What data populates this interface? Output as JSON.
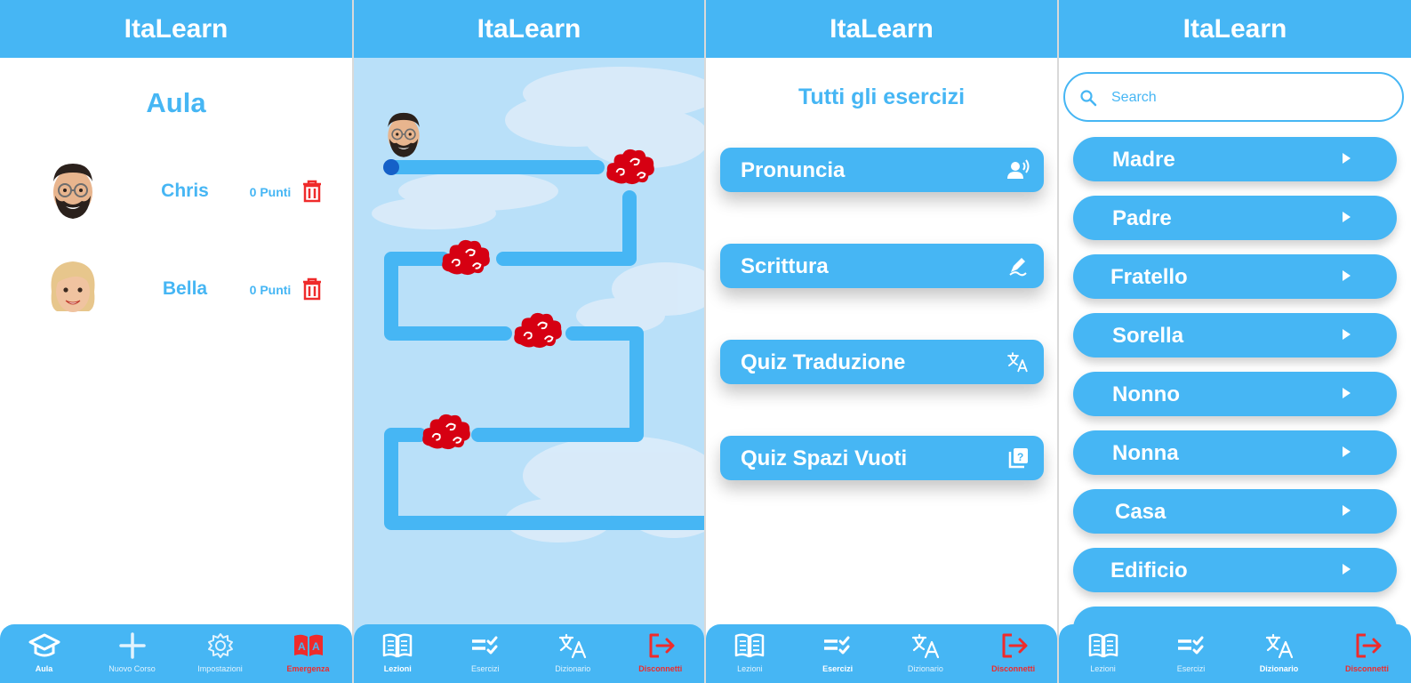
{
  "app_title": "ItaLearn",
  "colors": {
    "primary": "#46b6f4",
    "danger": "#ef2b2b",
    "path": "#46b6f4",
    "cloud_marker": "#d60012"
  },
  "screen1": {
    "title": "Aula",
    "students": [
      {
        "name": "Chris",
        "points": "0 Punti",
        "avatar": "bearded-man-memoji-icon"
      },
      {
        "name": "Bella",
        "points": "0 Punti",
        "avatar": "blonde-woman-memoji-icon"
      }
    ],
    "nav": [
      {
        "label": "Aula",
        "icon": "graduation-cap-icon",
        "state": "active"
      },
      {
        "label": "Nuovo Corso",
        "icon": "plus-icon",
        "state": "normal"
      },
      {
        "label": "Impostazioni",
        "icon": "gear-icon",
        "state": "normal"
      },
      {
        "label": "Emergenza",
        "icon": "dictionary-book-icon",
        "state": "red"
      }
    ]
  },
  "screen2": {
    "nav": [
      {
        "label": "Lezioni",
        "icon": "open-book-icon",
        "state": "active"
      },
      {
        "label": "Esercizi",
        "icon": "checklist-icon",
        "state": "normal"
      },
      {
        "label": "Dizionario",
        "icon": "translate-icon",
        "state": "normal"
      },
      {
        "label": "Disconnetti",
        "icon": "logout-icon",
        "state": "red"
      }
    ]
  },
  "screen3": {
    "title": "Tutti gli esercizi",
    "exercises": [
      {
        "label": "Pronuncia",
        "icon": "speaker-person-icon"
      },
      {
        "label": "Scrittura",
        "icon": "pencil-edit-icon"
      },
      {
        "label": "Quiz Traduzione",
        "icon": "translate-icon"
      },
      {
        "label": "Quiz Spazi Vuoti",
        "icon": "quiz-question-icon"
      }
    ],
    "nav": [
      {
        "label": "Lezioni",
        "icon": "open-book-icon",
        "state": "normal"
      },
      {
        "label": "Esercizi",
        "icon": "checklist-icon",
        "state": "active"
      },
      {
        "label": "Dizionario",
        "icon": "translate-icon",
        "state": "normal"
      },
      {
        "label": "Disconnetti",
        "icon": "logout-icon",
        "state": "red"
      }
    ]
  },
  "screen4": {
    "search_placeholder": "Search",
    "words": [
      "Madre",
      "Padre",
      "Fratello",
      "Sorella",
      "Nonno",
      "Nonna",
      "Casa",
      "Edificio"
    ],
    "nav": [
      {
        "label": "Lezioni",
        "icon": "open-book-icon",
        "state": "normal"
      },
      {
        "label": "Esercizi",
        "icon": "checklist-icon",
        "state": "normal"
      },
      {
        "label": "Dizionario",
        "icon": "translate-icon",
        "state": "active"
      },
      {
        "label": "Disconnetti",
        "icon": "logout-icon",
        "state": "red"
      }
    ]
  }
}
